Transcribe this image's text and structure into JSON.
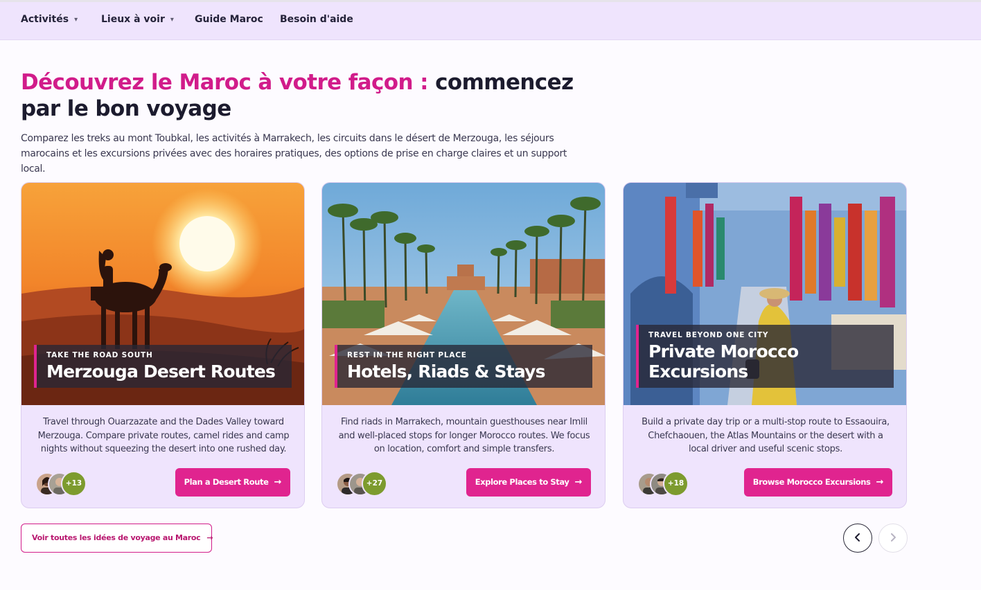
{
  "nav": {
    "items": [
      {
        "label": "Activités",
        "has_dropdown": true
      },
      {
        "label": "Lieux à voir",
        "has_dropdown": true
      },
      {
        "label": "Guide Maroc",
        "has_dropdown": false
      },
      {
        "label": "Besoin d'aide",
        "has_dropdown": false
      }
    ],
    "chevron": "⌄"
  },
  "hero": {
    "title_accent": "Découvrez le Maroc à votre façon :",
    "title_rest": " commencez par le bon voyage",
    "subtitle": "Comparez les treks au mont Toubkal, les activités à Marrakech, les circuits dans le désert de Merzouga, les séjours marocains et les excursions privées avec des horaires pratiques, des options de prise en charge claires et un support local."
  },
  "cards": [
    {
      "kicker": "Take the road south",
      "title": "Merzouga Desert Routes",
      "description": "Travel through Ouarzazate and the Dades Valley toward Merzouga. Compare private routes, camel rides and camp nights without squeezing the desert into one rushed day.",
      "avatar_count": "+13",
      "cta": "Plan a Desert Route",
      "image": "desert-sunset-camel-rider"
    },
    {
      "kicker": "Rest in the right place",
      "title": "Hotels, Riads & Stays",
      "description": "Find riads in Marrakech, mountain guesthouses near Imlil and well-placed stops for longer Morocco routes. We focus on location, comfort and simple transfers.",
      "avatar_count": "+27",
      "cta": "Explore Places to Stay",
      "image": "palm-resort-pool"
    },
    {
      "kicker": "Travel beyond one city",
      "title": "Private Morocco Excursions",
      "description": "Build a private day trip or a multi-stop route to Essaouira, Chefchaouen, the Atlas Mountains or the desert with a local driver and useful scenic stops.",
      "avatar_count": "+18",
      "cta": "Browse Morocco Excursions",
      "image": "chefchaouen-market-street"
    }
  ],
  "footer": {
    "see_all": "Voir toutes les idées de voyage au Maroc",
    "arrow": "→",
    "prev_icon": "‹",
    "next_icon": "›"
  },
  "colors": {
    "accent": "#d11c8a",
    "cta": "#e0248f",
    "nav_bg": "#efe4fd",
    "card_bg": "#efe4fd",
    "avatar_count_bg": "#7d9b2e"
  }
}
